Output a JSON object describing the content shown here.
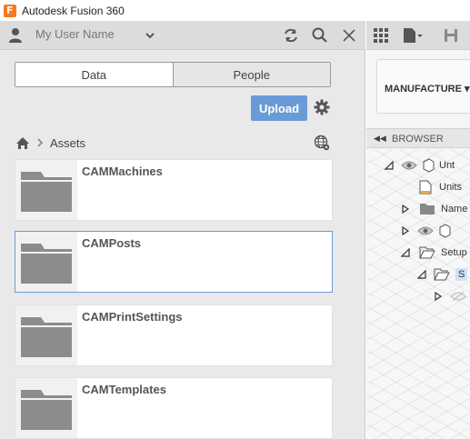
{
  "window": {
    "title": "Autodesk Fusion 360",
    "logo_letter": "F"
  },
  "user": {
    "name": "My User Name"
  },
  "data_panel": {
    "tabs": [
      {
        "label": "Data"
      },
      {
        "label": "People"
      }
    ],
    "upload_label": "Upload",
    "breadcrumb": {
      "current": "Assets"
    },
    "folders": [
      {
        "name": "CAMMachines",
        "selected": false
      },
      {
        "name": "CAMPosts",
        "selected": true
      },
      {
        "name": "CAMPrintSettings",
        "selected": false
      },
      {
        "name": "CAMTemplates",
        "selected": false
      }
    ]
  },
  "workspace": {
    "manufacture_label": "MANUFACTURE ▾",
    "browser_label": "BROWSER",
    "tree": [
      {
        "label": "Unt"
      },
      {
        "label": "Units"
      },
      {
        "label": "Name"
      },
      {
        "label": ""
      },
      {
        "label": "Setup"
      },
      {
        "label": "S"
      },
      {
        "label": ""
      }
    ]
  },
  "colors": {
    "accent": "#6a9bd6",
    "logo": "#f47a20",
    "selection": "#cfe2f6"
  }
}
